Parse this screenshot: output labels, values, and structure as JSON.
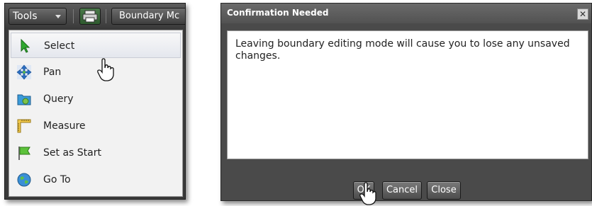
{
  "left": {
    "toolbar": {
      "tools_label": "Tools",
      "boundary_label": "Boundary Mc"
    },
    "menu": [
      {
        "label": "Select",
        "icon": "arrow-cursor-icon"
      },
      {
        "label": "Pan",
        "icon": "pan-arrows-icon"
      },
      {
        "label": "Query",
        "icon": "query-folder-icon"
      },
      {
        "label": "Measure",
        "icon": "ruler-icon"
      },
      {
        "label": "Set as Start",
        "icon": "flag-icon"
      },
      {
        "label": "Go To",
        "icon": "globe-icon"
      }
    ]
  },
  "dialog": {
    "title": "Confirmation Needed",
    "close_glyph": "✕",
    "message": "Leaving boundary editing mode will cause you to lose any unsaved changes.",
    "buttons": {
      "ok": "OK",
      "cancel": "Cancel",
      "close": "Close"
    }
  },
  "colors": {
    "menu_hover": "#e4e7ee",
    "dialog_frame": "#4a4a4a",
    "button": "#5a5a5a"
  }
}
